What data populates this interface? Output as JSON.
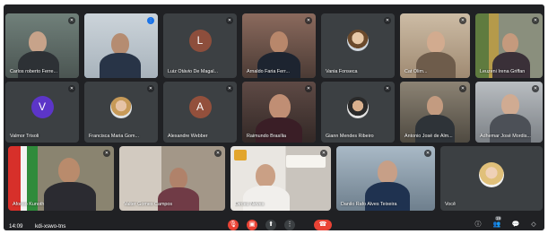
{
  "meeting": {
    "time": "14:09",
    "code": "kdi-xswo-tns"
  },
  "participants": [
    {
      "name": "Carlos roberto Ferre...",
      "type": "video",
      "tone": "#5e6a63"
    },
    {
      "name": "",
      "type": "video",
      "tone": "#b8c3cc",
      "speaking": true
    },
    {
      "name": "Luiz Otávio De Magal...",
      "type": "avatar",
      "initial": "L",
      "color": "#8d4e3c"
    },
    {
      "name": "Arnaldo Faria Ferr...",
      "type": "video",
      "tone": "#6d5a52"
    },
    {
      "name": "Vania Fonseca",
      "type": "photo"
    },
    {
      "name": "Cat Olim...",
      "type": "video",
      "tone": "#b9a288"
    },
    {
      "name": "Leuzeni Irena Griffan",
      "type": "video",
      "tone": "#7f8a6a"
    },
    {
      "name": "Valmor Trisoli",
      "type": "avatar",
      "initial": "V",
      "color": "#5c35c8"
    },
    {
      "name": "Francisca Maria Gom...",
      "type": "photo"
    },
    {
      "name": "Alexandre Webber",
      "type": "avatar",
      "initial": "A",
      "color": "#93503c"
    },
    {
      "name": "Raimundo Brasília",
      "type": "video",
      "tone": "#4a3b37"
    },
    {
      "name": "Giann Mendes Ribeiro",
      "type": "photo"
    },
    {
      "name": "Antonio José de Alm...",
      "type": "video",
      "tone": "#6b6257"
    },
    {
      "name": "Adhemar José Mordis...",
      "type": "video",
      "tone": "#8e9297"
    },
    {
      "name": "Afonso Kunoth",
      "type": "video",
      "tone": "#7d7a6a"
    },
    {
      "name": "Valter Gomes Campos",
      "type": "video",
      "tone": "#a99e93"
    },
    {
      "name": "Dirceu Neves",
      "type": "video",
      "tone": "#cfcac4"
    },
    {
      "name": "Danilo Rafo Alves Teixeira",
      "type": "video",
      "tone": "#90a3b3"
    },
    {
      "name": "Você",
      "type": "photo-self"
    }
  ],
  "controls": {
    "mic": "mic-off-icon",
    "camera": "camera-off-icon",
    "present": "present-icon",
    "more": "more-vert-icon",
    "hangup": "hangup-icon"
  },
  "right_controls": {
    "people_count": "19"
  },
  "colors": {
    "background": "#202124",
    "tile": "#3c4043",
    "danger": "#ea4335",
    "active": "#1a73e8"
  }
}
